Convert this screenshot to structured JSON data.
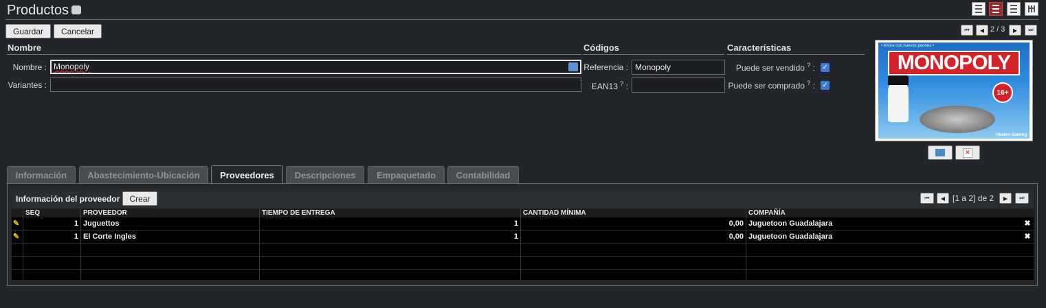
{
  "page": {
    "title": "Productos"
  },
  "toolbar": {
    "save_label": "Guardar",
    "cancel_label": "Cancelar"
  },
  "pager": {
    "text": "2 / 3"
  },
  "sections": {
    "nombre": "Nombre",
    "codigos": "Códigos",
    "caracteristicas": "Características"
  },
  "fields": {
    "nombre_label": "Nombre :",
    "nombre_value": "Monopoly",
    "variantes_label": "Variantes :",
    "variantes_value": "",
    "referencia_label": "Referencia :",
    "referencia_value": "Monopoly",
    "ean13_label": "EAN13",
    "ean13_value": "",
    "help_mark": "?",
    "colon": ":",
    "vendido_label": "Puede ser vendido",
    "vendido_checked": true,
    "comprado_label": "Puede ser comprado",
    "comprado_checked": true
  },
  "image": {
    "brand": "MONOPOLY",
    "tagline": "• Ahora con nuevos peones •",
    "badge": "16+",
    "maker": "Hasbro Gaming"
  },
  "tabs": [
    "Información",
    "Abastecimiento-Ubicación",
    "Proveedores",
    "Descripciones",
    "Empaquetado",
    "Contabilidad"
  ],
  "active_tab": "Proveedores",
  "suppliers": {
    "title": "Información del proveedor",
    "create_label": "Crear",
    "pager_text": "[1 a 2] de 2",
    "columns": [
      "SEQ",
      "PROVEEDOR",
      "TIEMPO DE ENTREGA",
      "CANTIDAD MÍNIMA",
      "COMPAÑÍA"
    ],
    "rows": [
      {
        "seq": "1",
        "proveedor": "Juguettos",
        "tiempo": "1",
        "cantidad": "0,00",
        "compania": "Juguetoon Guadalajara"
      },
      {
        "seq": "1",
        "proveedor": "El Corte Ingles",
        "tiempo": "1",
        "cantidad": "0,00",
        "compania": "Juguetoon Guadalajara"
      }
    ]
  },
  "colors": {
    "accent": "#3b7bd6",
    "active_view": "#9a2a2a",
    "background": "#22262a"
  }
}
